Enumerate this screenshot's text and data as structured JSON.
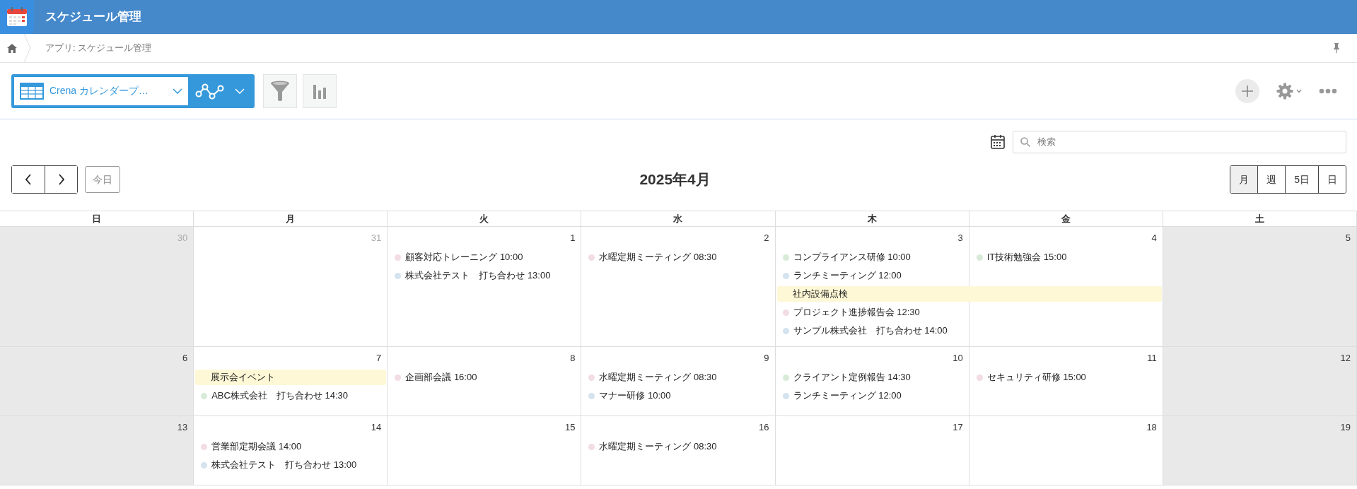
{
  "app": {
    "title": "スケジュール管理"
  },
  "breadcrumb": [
    {
      "label": "アプリ: スケジュール管理"
    }
  ],
  "toolbar": {
    "view_select": {
      "value": "Crena カレンダープ…"
    }
  },
  "search": {
    "placeholder": "検索"
  },
  "nav": {
    "today": "今日"
  },
  "calendar": {
    "title": "2025年4月",
    "views": [
      {
        "label": "月",
        "selected": true
      },
      {
        "label": "週",
        "selected": false
      },
      {
        "label": "5日",
        "selected": false
      },
      {
        "label": "日",
        "selected": false
      }
    ],
    "weekdays": [
      "日",
      "月",
      "火",
      "水",
      "木",
      "金",
      "土"
    ],
    "weeks": [
      {
        "days": [
          {
            "date": "30",
            "other_month": true
          },
          {
            "date": "31",
            "other_month": true
          },
          {
            "date": "1",
            "other_month": false,
            "events": [
              {
                "kind": "timed",
                "label": "顧客対応トレーニング 10:00",
                "color": "#f2dce5"
              },
              {
                "kind": "timed",
                "label": "株式会社テスト　打ち合わせ 13:00",
                "color": "#d5e3ef"
              }
            ]
          },
          {
            "date": "2",
            "other_month": false,
            "events": [
              {
                "kind": "timed",
                "label": "水曜定期ミーティング 08:30",
                "color": "#f2dce5"
              }
            ]
          },
          {
            "date": "3",
            "other_month": false,
            "events": [
              {
                "kind": "timed",
                "label": "コンプライアンス研修 10:00",
                "color": "#d8ebd8"
              },
              {
                "kind": "timed",
                "label": "ランチミーティング 12:00",
                "color": "#d5e3ef"
              },
              {
                "kind": "allday",
                "label": "社内設備点検",
                "spans_next_day": true
              },
              {
                "kind": "timed",
                "label": "プロジェクト進捗報告会 12:30",
                "color": "#f2dce5"
              },
              {
                "kind": "timed",
                "label": "サンプル株式会社　打ち合わせ 14:00",
                "color": "#d5e3ef"
              }
            ]
          },
          {
            "date": "4",
            "other_month": false,
            "events": [
              {
                "kind": "timed",
                "label": "IT技術勉強会 15:00",
                "color": "#d8ebd8"
              }
            ]
          },
          {
            "date": "5",
            "other_month": false
          }
        ]
      },
      {
        "days": [
          {
            "date": "6",
            "other_month": false
          },
          {
            "date": "7",
            "other_month": false,
            "events": [
              {
                "kind": "allday",
                "label": "展示会イベント",
                "spans_next_day": false
              },
              {
                "kind": "timed",
                "label": "ABC株式会社　打ち合わせ 14:30",
                "color": "#d8ebd8"
              }
            ]
          },
          {
            "date": "8",
            "other_month": false,
            "events": [
              {
                "kind": "timed",
                "label": "企画部会議 16:00",
                "color": "#f2dce5"
              }
            ]
          },
          {
            "date": "9",
            "other_month": false,
            "events": [
              {
                "kind": "timed",
                "label": "水曜定期ミーティング 08:30",
                "color": "#f2dce5"
              },
              {
                "kind": "timed",
                "label": "マナー研修 10:00",
                "color": "#d5e3ef"
              }
            ]
          },
          {
            "date": "10",
            "other_month": false,
            "events": [
              {
                "kind": "timed",
                "label": "クライアント定例報告 14:30",
                "color": "#d8ebd8"
              },
              {
                "kind": "timed",
                "label": "ランチミーティング 12:00",
                "color": "#d5e3ef"
              }
            ]
          },
          {
            "date": "11",
            "other_month": false,
            "events": [
              {
                "kind": "timed",
                "label": "セキュリティ研修 15:00",
                "color": "#f2dce5"
              }
            ]
          },
          {
            "date": "12",
            "other_month": false
          }
        ]
      },
      {
        "days": [
          {
            "date": "13",
            "other_month": false
          },
          {
            "date": "14",
            "other_month": false,
            "events": [
              {
                "kind": "timed",
                "label": "営業部定期会議 14:00",
                "color": "#f2dce5"
              },
              {
                "kind": "timed",
                "label": "株式会社テスト　打ち合わせ 13:00",
                "color": "#d5e3ef"
              }
            ]
          },
          {
            "date": "15",
            "other_month": false
          },
          {
            "date": "16",
            "other_month": false,
            "events": [
              {
                "kind": "timed",
                "label": "水曜定期ミーティング 08:30",
                "color": "#f2dce5"
              }
            ]
          },
          {
            "date": "17",
            "other_month": false
          },
          {
            "date": "18",
            "other_month": false
          },
          {
            "date": "19",
            "other_month": false
          }
        ]
      }
    ]
  }
}
